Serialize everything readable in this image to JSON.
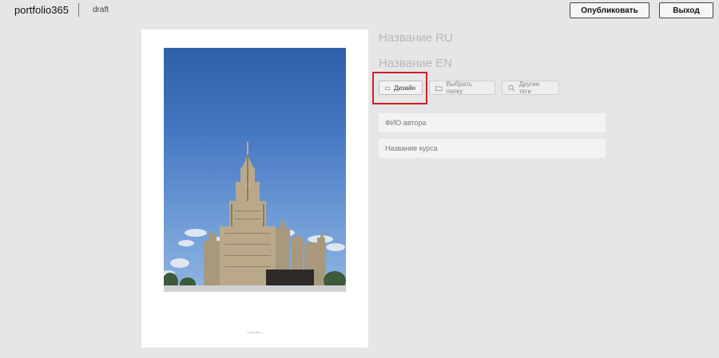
{
  "header": {
    "logo": "portfolio365",
    "status": "draft",
    "publish_label": "Опубликовать",
    "exit_label": "Выход"
  },
  "preview": {
    "photo_alt": "Photo of a tall building",
    "caption": "portfolio365.ru"
  },
  "form": {
    "title_ru": "Название RU",
    "title_en": "Название EN",
    "tags": [
      {
        "label": "Дизайн",
        "icon": "folder-icon"
      },
      {
        "label": "Выбрать папку",
        "icon": "folder-icon"
      },
      {
        "label": "Другие теги",
        "icon": "search-icon"
      }
    ],
    "author_placeholder": "ФИО автора",
    "course_placeholder": "Название курса"
  },
  "colors": {
    "background": "#e6e6e6",
    "highlight": "#d11f2a"
  }
}
